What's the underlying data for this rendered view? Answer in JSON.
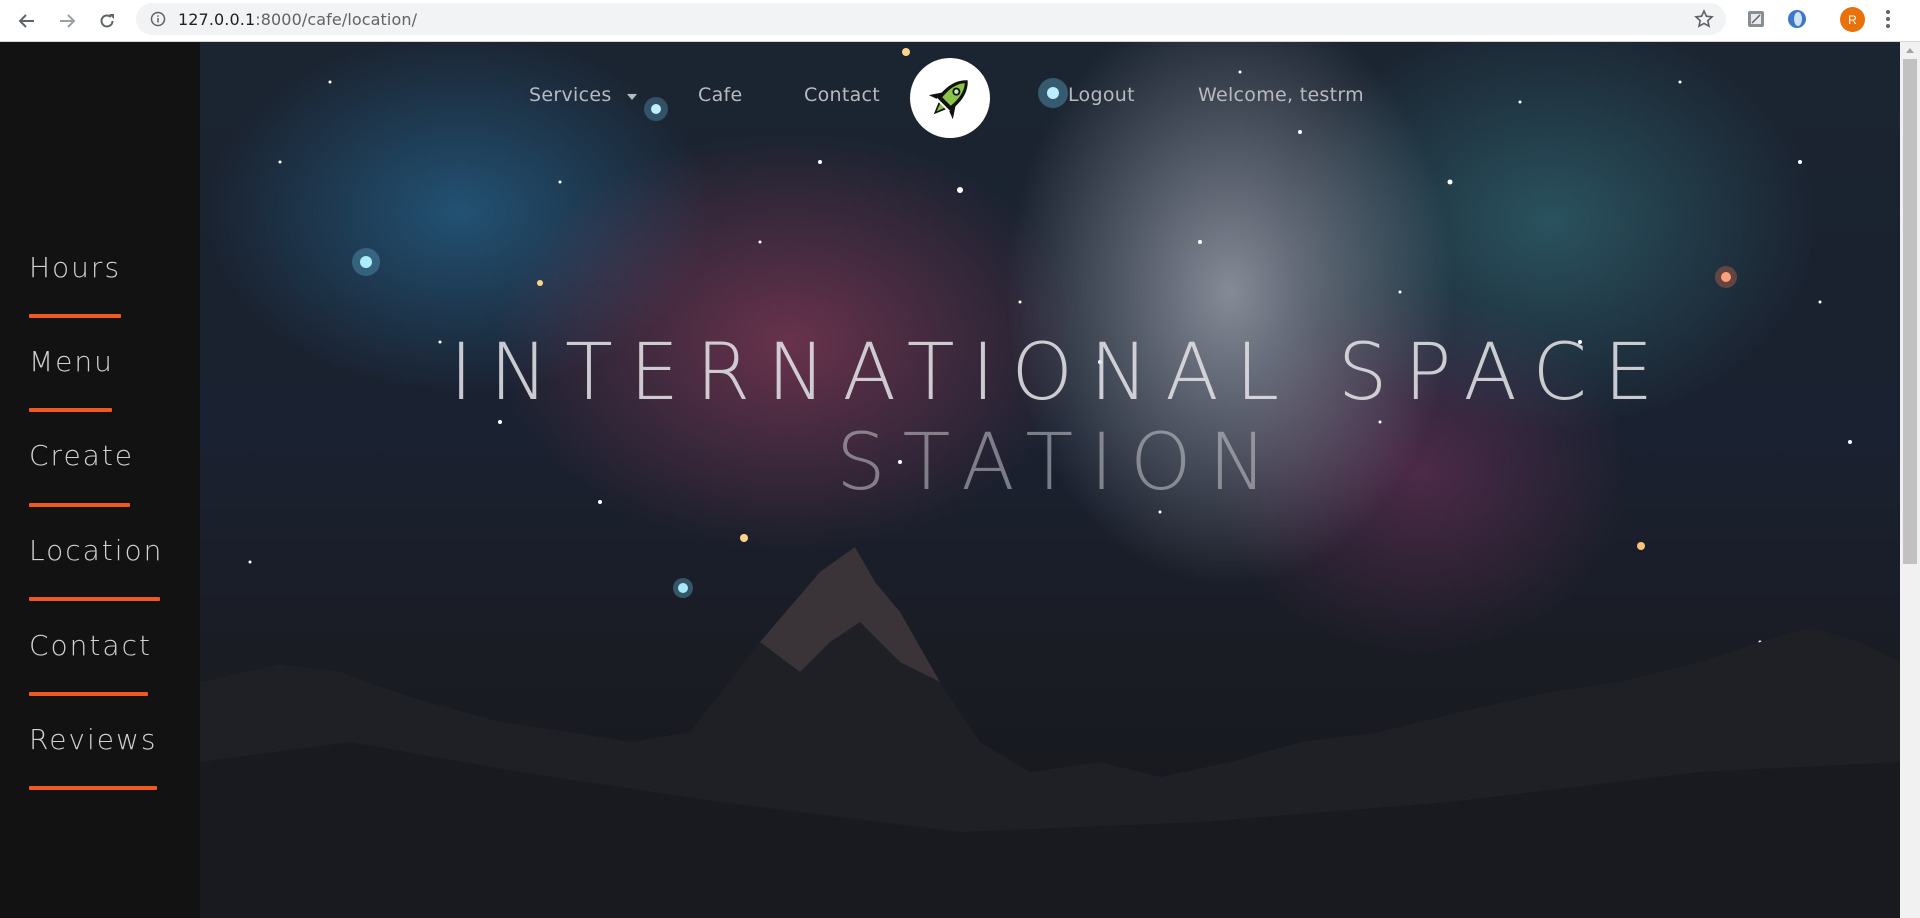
{
  "browser": {
    "url_host": "127.0.0.1",
    "url_rest": ":8000/cafe/location/",
    "profile_initial": "R",
    "icons": [
      "back-icon",
      "forward-icon",
      "reload-icon",
      "info-icon",
      "star-icon",
      "extension-icon",
      "extension-icon",
      "menu-icon"
    ]
  },
  "sidebar": {
    "items": [
      {
        "label": "Hours"
      },
      {
        "label": "Menu"
      },
      {
        "label": "Create"
      },
      {
        "label": "Location"
      },
      {
        "label": "Contact"
      },
      {
        "label": "Reviews"
      }
    ],
    "accent": "#f05a1e"
  },
  "topnav": {
    "services": "Services",
    "cafe": "Cafe",
    "contact": "Contact",
    "logout": "Logout",
    "welcome": "Welcome, testrm"
  },
  "hero": {
    "title_line1": "INTERNATIONAL SPACE",
    "title_line2": "STATION"
  }
}
